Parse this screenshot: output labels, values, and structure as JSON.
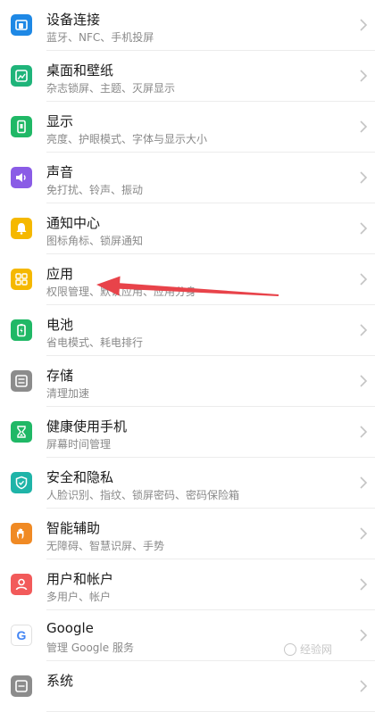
{
  "colors": {
    "title": "#1a1a1a",
    "subtitle": "#8a8a8a",
    "annotation_arrow": "#e8434a"
  },
  "settings_list": {
    "items": [
      {
        "name": "device-connection",
        "title": "设备连接",
        "subtitle": "蓝牙、NFC、手机投屏",
        "icon": "device-link-icon",
        "color": "#1e88e5"
      },
      {
        "name": "home-wallpaper",
        "title": "桌面和壁纸",
        "subtitle": "杂志锁屏、主题、灭屏显示",
        "icon": "wallpaper-icon",
        "color": "#1fb47a"
      },
      {
        "name": "display",
        "title": "显示",
        "subtitle": "亮度、护眼模式、字体与显示大小",
        "icon": "display-icon",
        "color": "#20b866"
      },
      {
        "name": "sound",
        "title": "声音",
        "subtitle": "免打扰、铃声、振动",
        "icon": "speaker-icon",
        "color": "#8a5ce6"
      },
      {
        "name": "notification-center",
        "title": "通知中心",
        "subtitle": "图标角标、锁屏通知",
        "icon": "bell-icon",
        "color": "#f5b800"
      },
      {
        "name": "apps",
        "title": "应用",
        "subtitle": "权限管理、默认应用、应用分身",
        "icon": "apps-grid-icon",
        "color": "#f5b800"
      },
      {
        "name": "battery",
        "title": "电池",
        "subtitle": "省电模式、耗电排行",
        "icon": "battery-icon",
        "color": "#20b866"
      },
      {
        "name": "storage",
        "title": "存储",
        "subtitle": "清理加速",
        "icon": "storage-icon",
        "color": "#8c8c8c"
      },
      {
        "name": "digital-balance",
        "title": "健康使用手机",
        "subtitle": "屏幕时间管理",
        "icon": "hourglass-icon",
        "color": "#20b866"
      },
      {
        "name": "security-privacy",
        "title": "安全和隐私",
        "subtitle": "人脸识别、指纹、锁屏密码、密码保险箱",
        "icon": "shield-icon",
        "color": "#1fb4a8"
      },
      {
        "name": "accessibility",
        "title": "智能辅助",
        "subtitle": "无障碍、智慧识屏、手势",
        "icon": "hand-icon",
        "color": "#f08a24"
      },
      {
        "name": "users-accounts",
        "title": "用户和帐户",
        "subtitle": "多用户、帐户",
        "icon": "user-icon",
        "color": "#f25a5a"
      },
      {
        "name": "google",
        "title": "Google",
        "subtitle": "管理 Google 服务",
        "icon": "google-icon",
        "color": "#ffffff"
      },
      {
        "name": "system",
        "title": "系统",
        "subtitle": "",
        "icon": "system-icon",
        "color": "#8c8c8c"
      }
    ]
  },
  "watermark": {
    "text": "经验网"
  }
}
